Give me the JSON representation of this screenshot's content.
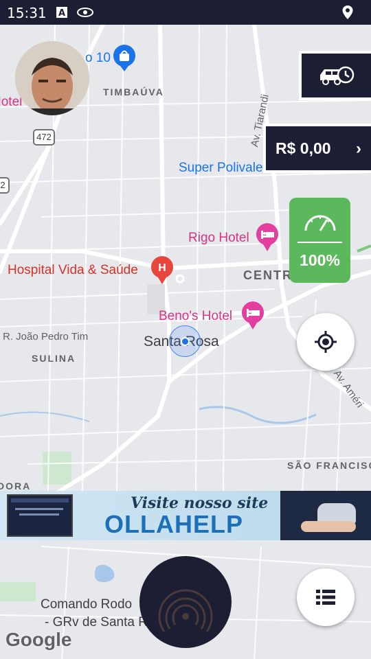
{
  "status_bar": {
    "time": "15:31",
    "icons": [
      "text-a-icon",
      "eye-icon",
      "location-pin-icon"
    ]
  },
  "map": {
    "poi_labels": {
      "top_left_fragment": "o 10",
      "hotel_fragment": "Hotel",
      "super": "Super Polivalente",
      "rigo": "Rigo Hotel",
      "hospital": "Hospital Vida & Saúde",
      "benos": "Beno's Hotel"
    },
    "districts": {
      "timbauva": "TIMBAÚVA",
      "centro": "CENTR",
      "sulina": "SULINA",
      "sao_francisco": "SÃO FRANCISC",
      "dora": "DORA"
    },
    "streets": {
      "joao_pedro": "R. João Pedro Tim",
      "tiaraju": "Av. Tiarandi",
      "america": "Av. Améri",
      "route_472": "472",
      "route_left": "2"
    },
    "city": "Santa Rosa",
    "comando_line1": "Comando Rodo",
    "comando_line2": "- GRv de Santa R",
    "attribution": "Google"
  },
  "controls": {
    "balance": "R$ 0,00",
    "battery_pct": "100%"
  },
  "banner": {
    "line1": "Visite nosso site",
    "line2": "OLLAHELP"
  },
  "colors": {
    "status_bar": "#1c1f33",
    "dark_button": "#1c1f33",
    "speed_card": "#5cb85c",
    "poi_blue": "#1a73e8",
    "poi_pink": "#d63384",
    "poi_red": "#d93025"
  }
}
